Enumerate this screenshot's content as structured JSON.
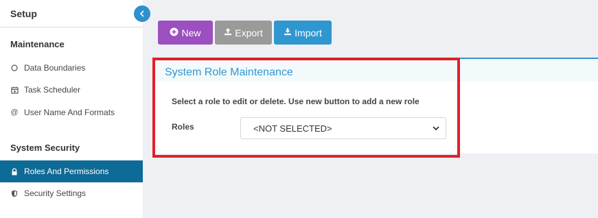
{
  "sidebar": {
    "title": "Setup",
    "collapse_icon": "chevron-left-icon",
    "sections": [
      {
        "title": "Maintenance",
        "items": [
          {
            "label": "Data Boundaries",
            "icon": "circle-outline-icon"
          },
          {
            "label": "Task Scheduler",
            "icon": "calendar-icon"
          },
          {
            "label": "User Name And Formats",
            "icon": "at-sign-icon"
          }
        ]
      },
      {
        "title": "System Security",
        "items": [
          {
            "label": "Roles And Permissions",
            "icon": "lock-icon",
            "active": true
          },
          {
            "label": "Security Settings",
            "icon": "shield-icon"
          }
        ]
      }
    ]
  },
  "toolbar": {
    "new_label": "New",
    "export_label": "Export",
    "import_label": "Import"
  },
  "panel": {
    "title": "System Role Maintenance",
    "instructions": "Select a role to edit or delete. Use new button to add a new role",
    "roles_label": "Roles",
    "roles_selected": "<NOT SELECTED>"
  },
  "colors": {
    "active_nav": "#0e6a96",
    "new_button": "#9c4fbf",
    "export_button": "#9a9a9a",
    "import_button": "#2f97cf",
    "panel_title": "#2f97cf",
    "highlight": "#e0202a"
  }
}
